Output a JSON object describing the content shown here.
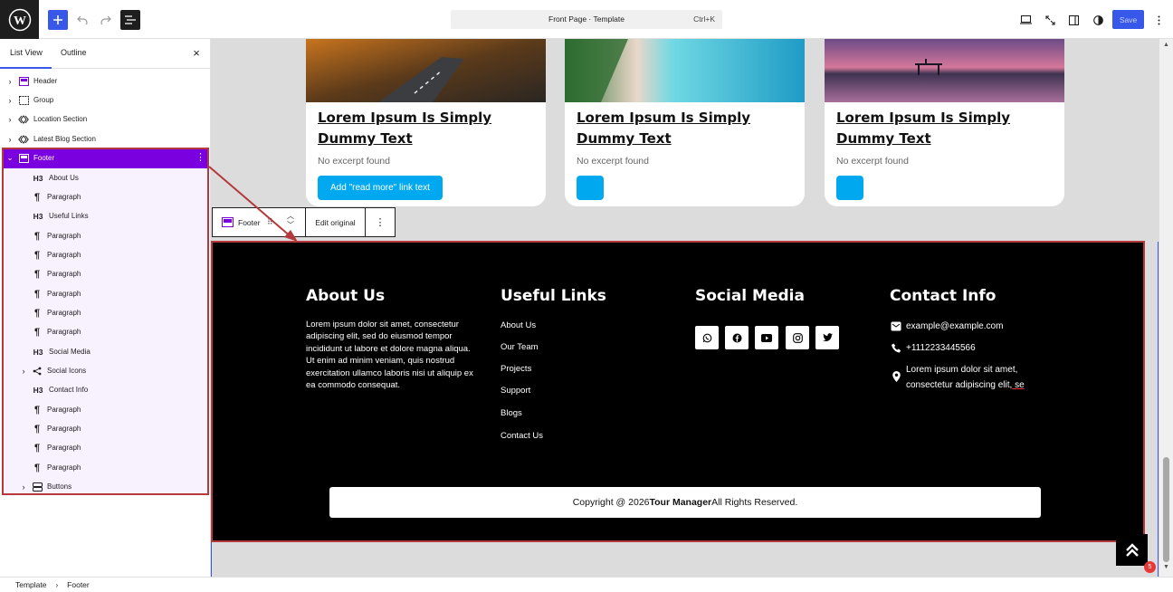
{
  "topbar": {
    "doc_title": "Front Page · Template",
    "shortcut": "Ctrl+K",
    "save_label": "Save"
  },
  "sidebar": {
    "tabs": [
      "List View",
      "Outline"
    ],
    "close_glyph": "×",
    "items": [
      {
        "label": "Header",
        "icon": "template-part-icon",
        "chevron": "›"
      },
      {
        "label": "Group",
        "icon": "group-icon",
        "chevron": "›"
      },
      {
        "label": "Location Section",
        "icon": "pattern-icon",
        "chevron": "›"
      },
      {
        "label": "Latest Blog Section",
        "icon": "pattern-icon",
        "chevron": "›"
      },
      {
        "label": "Footer",
        "icon": "template-part-icon",
        "chevron": "⌄",
        "selected": true
      },
      {
        "label": "About Us",
        "icon": "heading-icon",
        "glyph": "H3"
      },
      {
        "label": "Paragraph",
        "icon": "paragraph-icon",
        "glyph": "¶"
      },
      {
        "label": "Useful Links",
        "icon": "heading-icon",
        "glyph": "H3"
      },
      {
        "label": "Paragraph",
        "icon": "paragraph-icon",
        "glyph": "¶"
      },
      {
        "label": "Paragraph",
        "icon": "paragraph-icon",
        "glyph": "¶"
      },
      {
        "label": "Paragraph",
        "icon": "paragraph-icon",
        "glyph": "¶"
      },
      {
        "label": "Paragraph",
        "icon": "paragraph-icon",
        "glyph": "¶"
      },
      {
        "label": "Paragraph",
        "icon": "paragraph-icon",
        "glyph": "¶"
      },
      {
        "label": "Paragraph",
        "icon": "paragraph-icon",
        "glyph": "¶"
      },
      {
        "label": "Social Media",
        "icon": "heading-icon",
        "glyph": "H3"
      },
      {
        "label": "Social Icons",
        "icon": "share-icon",
        "chevron": "›"
      },
      {
        "label": "Contact Info",
        "icon": "heading-icon",
        "glyph": "H3"
      },
      {
        "label": "Paragraph",
        "icon": "paragraph-icon",
        "glyph": "¶"
      },
      {
        "label": "Paragraph",
        "icon": "paragraph-icon",
        "glyph": "¶"
      },
      {
        "label": "Paragraph",
        "icon": "paragraph-icon",
        "glyph": "¶"
      },
      {
        "label": "Paragraph",
        "icon": "paragraph-icon",
        "glyph": "¶"
      },
      {
        "label": "Buttons",
        "icon": "buttons-icon",
        "chevron": "›"
      }
    ]
  },
  "cards": [
    {
      "title": "Lorem Ipsum Is Simply Dummy Text",
      "excerpt": "No excerpt found",
      "button": "Add \"read more\" link text"
    },
    {
      "title": "Lorem Ipsum Is Simply Dummy Text",
      "excerpt": "No excerpt found",
      "button": ""
    },
    {
      "title": "Lorem Ipsum Is Simply Dummy Text",
      "excerpt": "No excerpt found",
      "button": ""
    }
  ],
  "block_toolbar": {
    "block_name": "Footer",
    "edit_label": "Edit original",
    "more_glyph": "⋮"
  },
  "footer": {
    "about": {
      "heading": "About Us",
      "text": "Lorem ipsum dolor sit amet, consectetur adipiscing elit, sed do eiusmod tempor incididunt ut labore et dolore magna aliqua. Ut enim ad minim veniam, quis nostrud exercitation ullamco laboris nisi ut aliquip ex ea commodo consequat."
    },
    "links": {
      "heading": "Useful Links",
      "items": [
        "About Us",
        "Our Team",
        "Projects",
        "Support",
        "Blogs",
        "Contact Us"
      ]
    },
    "social": {
      "heading": "Social Media",
      "icons": [
        "whatsapp-icon",
        "facebook-icon",
        "youtube-icon",
        "instagram-icon",
        "twitter-icon"
      ]
    },
    "contact": {
      "heading": "Contact Info",
      "email": "example@example.com",
      "phone": "+1112233445566",
      "address_line1": "Lorem ipsum dolor sit amet,",
      "address_line2_a": "consectetur adipiscing elit,",
      "address_line2_b": " se"
    },
    "copyright": {
      "prefix": "Copyright @ 2026 ",
      "brand": "Tour Manager",
      "suffix": " All Rights Reserved."
    }
  },
  "notification_count": "5",
  "breadcrumb": [
    "Template",
    "Footer"
  ],
  "breadcrumb_sep": "›",
  "colors": {
    "accent": "#3858e9",
    "selection": "#7a00df",
    "highlight": "#b5383c",
    "card_button": "#00a8f0"
  }
}
